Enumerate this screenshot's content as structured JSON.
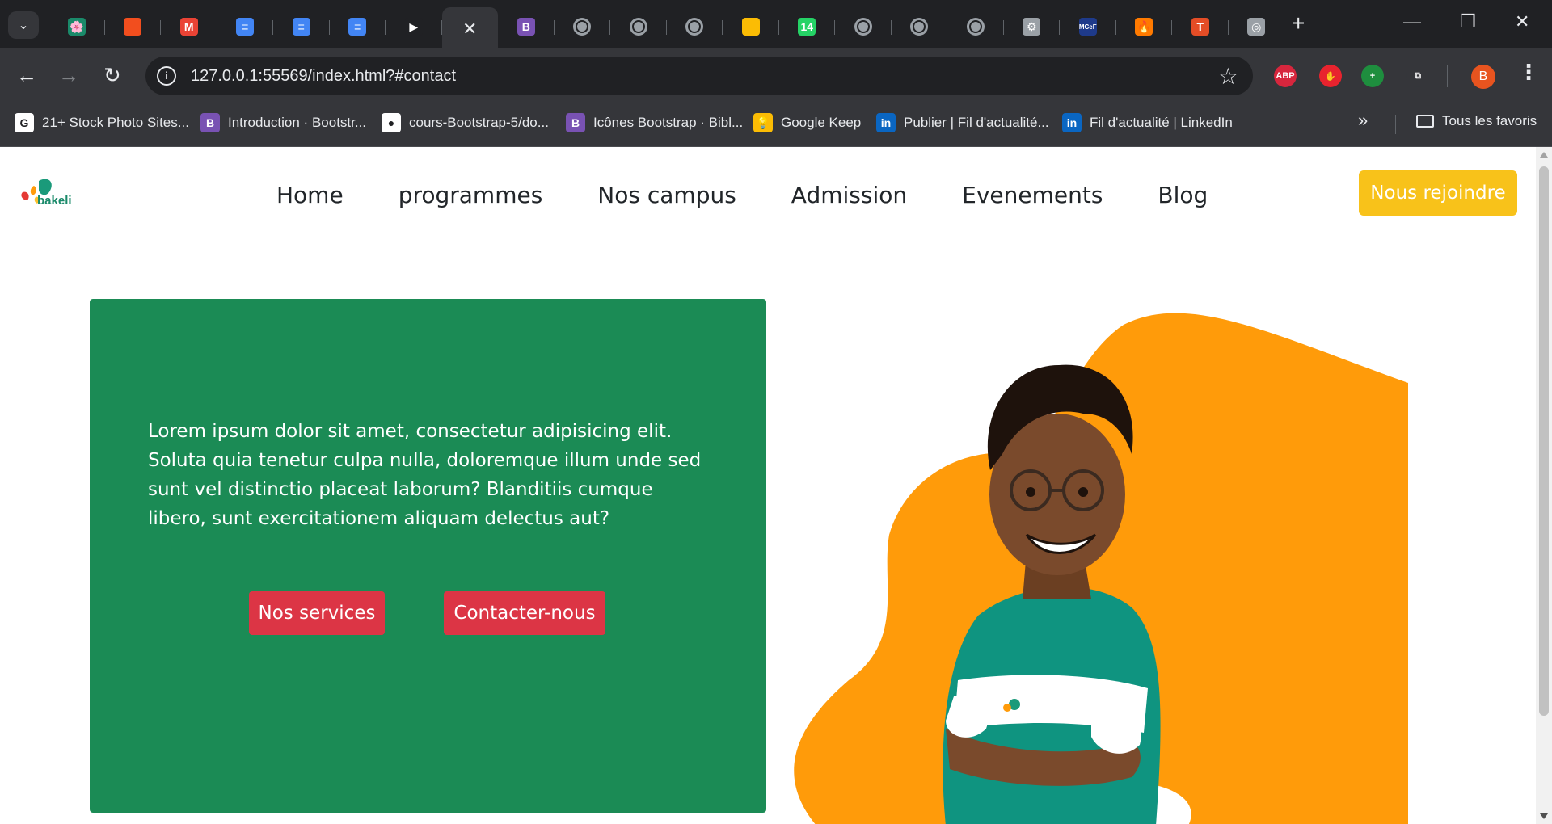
{
  "browser": {
    "tabs": [
      {
        "icon": "bakeli-favicon",
        "color": "#1a8a6a",
        "glyph": "🌸"
      },
      {
        "icon": "figma-favicon",
        "color": "#f24e1e",
        "glyph": ""
      },
      {
        "icon": "gmail-favicon",
        "color": "#ea4335",
        "glyph": "M"
      },
      {
        "icon": "google-docs-favicon",
        "color": "#4285f4",
        "glyph": "≡"
      },
      {
        "icon": "google-docs-favicon",
        "color": "#4285f4",
        "glyph": "≡"
      },
      {
        "icon": "google-docs-favicon",
        "color": "#4285f4",
        "glyph": "≡"
      },
      {
        "icon": "media-play-favicon",
        "color": "#202124",
        "glyph": "▶"
      },
      {
        "icon": "close-icon",
        "color": "#35363a",
        "glyph": "✕",
        "active": true
      },
      {
        "icon": "bootstrap-favicon",
        "color": "#7952b3",
        "glyph": "B"
      },
      {
        "icon": "globe-favicon",
        "color": "#9aa0a6",
        "glyph": ""
      },
      {
        "icon": "globe-favicon",
        "color": "#9aa0a6",
        "glyph": ""
      },
      {
        "icon": "globe-favicon",
        "color": "#9aa0a6",
        "glyph": ""
      },
      {
        "icon": "google-keep-favicon",
        "color": "#fbbc04",
        "glyph": ""
      },
      {
        "icon": "whatsapp-favicon",
        "color": "#25d366",
        "glyph": "14"
      },
      {
        "icon": "globe-favicon",
        "color": "#9aa0a6",
        "glyph": ""
      },
      {
        "icon": "globe-favicon",
        "color": "#9aa0a6",
        "glyph": ""
      },
      {
        "icon": "globe-favicon",
        "color": "#9aa0a6",
        "glyph": ""
      },
      {
        "icon": "settings-gear-favicon",
        "color": "#9aa0a6",
        "glyph": "⚙"
      },
      {
        "icon": "mcef-favicon",
        "color": "#1e3a8a",
        "glyph": "MCeF"
      },
      {
        "icon": "flame-favicon",
        "color": "#ff7a00",
        "glyph": "🔥"
      },
      {
        "icon": "t-favicon",
        "color": "#e44d26",
        "glyph": "T"
      },
      {
        "icon": "chrome-favicon",
        "color": "#9aa0a6",
        "glyph": "◎"
      }
    ],
    "new_tab": "+",
    "minimize": "—",
    "restore": "❐",
    "close": "✕",
    "url": "127.0.0.1:55569/index.html?#contact",
    "extensions": [
      {
        "icon": "adblock-plus-icon",
        "label": "ABP",
        "color": "#d7263d"
      },
      {
        "icon": "stop-hand-icon",
        "label": "✋",
        "color": "#e8232e"
      },
      {
        "icon": "plus-circle-icon",
        "label": "+",
        "color": "#1e8e3e"
      },
      {
        "icon": "puzzle-extensions-icon",
        "label": "⧉",
        "color": "#35363a"
      }
    ],
    "profile_initial": "B",
    "bookmarks": [
      {
        "icon": "google-icon",
        "label": "21+ Stock Photo Sites...",
        "color": "#ffffff",
        "glyph": "G"
      },
      {
        "icon": "bootstrap-icon",
        "label": "Introduction · Bootstr...",
        "color": "#7952b3",
        "glyph": "B"
      },
      {
        "icon": "github-icon",
        "label": "cours-Bootstrap-5/do...",
        "color": "#ffffff",
        "glyph": "●"
      },
      {
        "icon": "bootstrap-icon",
        "label": "Icônes Bootstrap · Bibl...",
        "color": "#7952b3",
        "glyph": "B"
      },
      {
        "icon": "google-keep-icon",
        "label": "Google Keep",
        "color": "#fbbc04",
        "glyph": "💡"
      },
      {
        "icon": "linkedin-icon",
        "label": "Publier | Fil d'actualité...",
        "color": "#0a66c2",
        "glyph": "in"
      },
      {
        "icon": "linkedin-icon",
        "label": "Fil d'actualité | LinkedIn",
        "color": "#0a66c2",
        "glyph": "in"
      }
    ],
    "bookmarks_overflow": "»",
    "all_bookmarks": "Tous les favoris"
  },
  "site": {
    "logo_text": "bakeli",
    "nav": [
      "Home",
      "programmes",
      "Nos campus",
      "Admission",
      "Evenements",
      "Blog"
    ],
    "join_button": "Nous rejoindre",
    "hero": {
      "text": "Lorem ipsum dolor sit amet, consectetur adipisicing elit. Soluta quia tenetur culpa nulla, doloremque illum unde sed sunt vel distinctio placeat laborum? Blanditiis cumque libero, sunt exercitationem aliquam delectus aut?",
      "services_button": "Nos services",
      "contact_button": "Contacter-nous"
    },
    "colors": {
      "brand_green": "#1b8b55",
      "accent_yellow": "#f8c21a",
      "cta_red": "#dc3545",
      "blob_orange": "#ff9b0a",
      "shirt_teal": "#0f9480"
    }
  }
}
